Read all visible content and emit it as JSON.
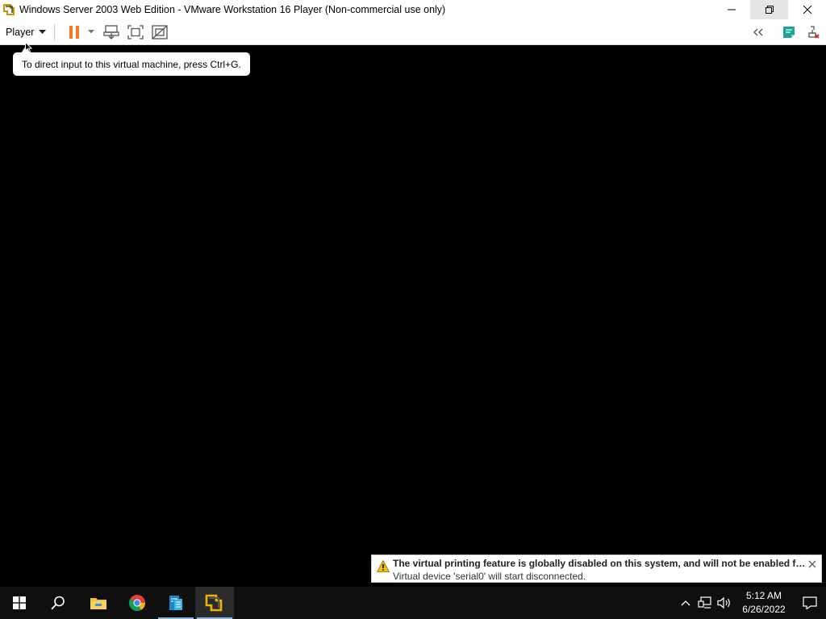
{
  "window": {
    "title": "Windows Server 2003 Web Edition - VMware Workstation 16 Player (Non-commercial use only)",
    "controls": [
      "minimize",
      "restore",
      "close"
    ]
  },
  "toolbar": {
    "player_menu_label": "Player",
    "left_icons": [
      "pause-icon",
      "dropdown-arrow-icon",
      "send-ctrl-alt-del-icon",
      "full-screen-icon",
      "unity-icon"
    ],
    "right_icons": [
      "collapse-toolbar-icon",
      "message-log-icon",
      "removable-devices-icon"
    ]
  },
  "tooltip": {
    "text": "To direct input to this virtual machine, press Ctrl+G."
  },
  "notification": {
    "title": "The virtual printing feature is globally disabled on this system, and will not be enabled for this virtual machine.",
    "detail": "Virtual device 'serial0' will start disconnected."
  },
  "taskbar": {
    "apps": [
      "start-icon",
      "search-icon",
      "file-explorer-icon",
      "chrome-icon",
      "server-manager-icon",
      "vmware-player-icon"
    ],
    "tray_icons": [
      "show-hidden-icons-icon",
      "network-icon",
      "volume-icon"
    ],
    "time": "5:12 AM",
    "date": "6/26/2022"
  },
  "colors": {
    "accent_orange": "#f47b20",
    "vmware_gold": "#f0b400",
    "notif_warning": "#f5c400",
    "taskbar_bg": "#0f0f0f"
  }
}
